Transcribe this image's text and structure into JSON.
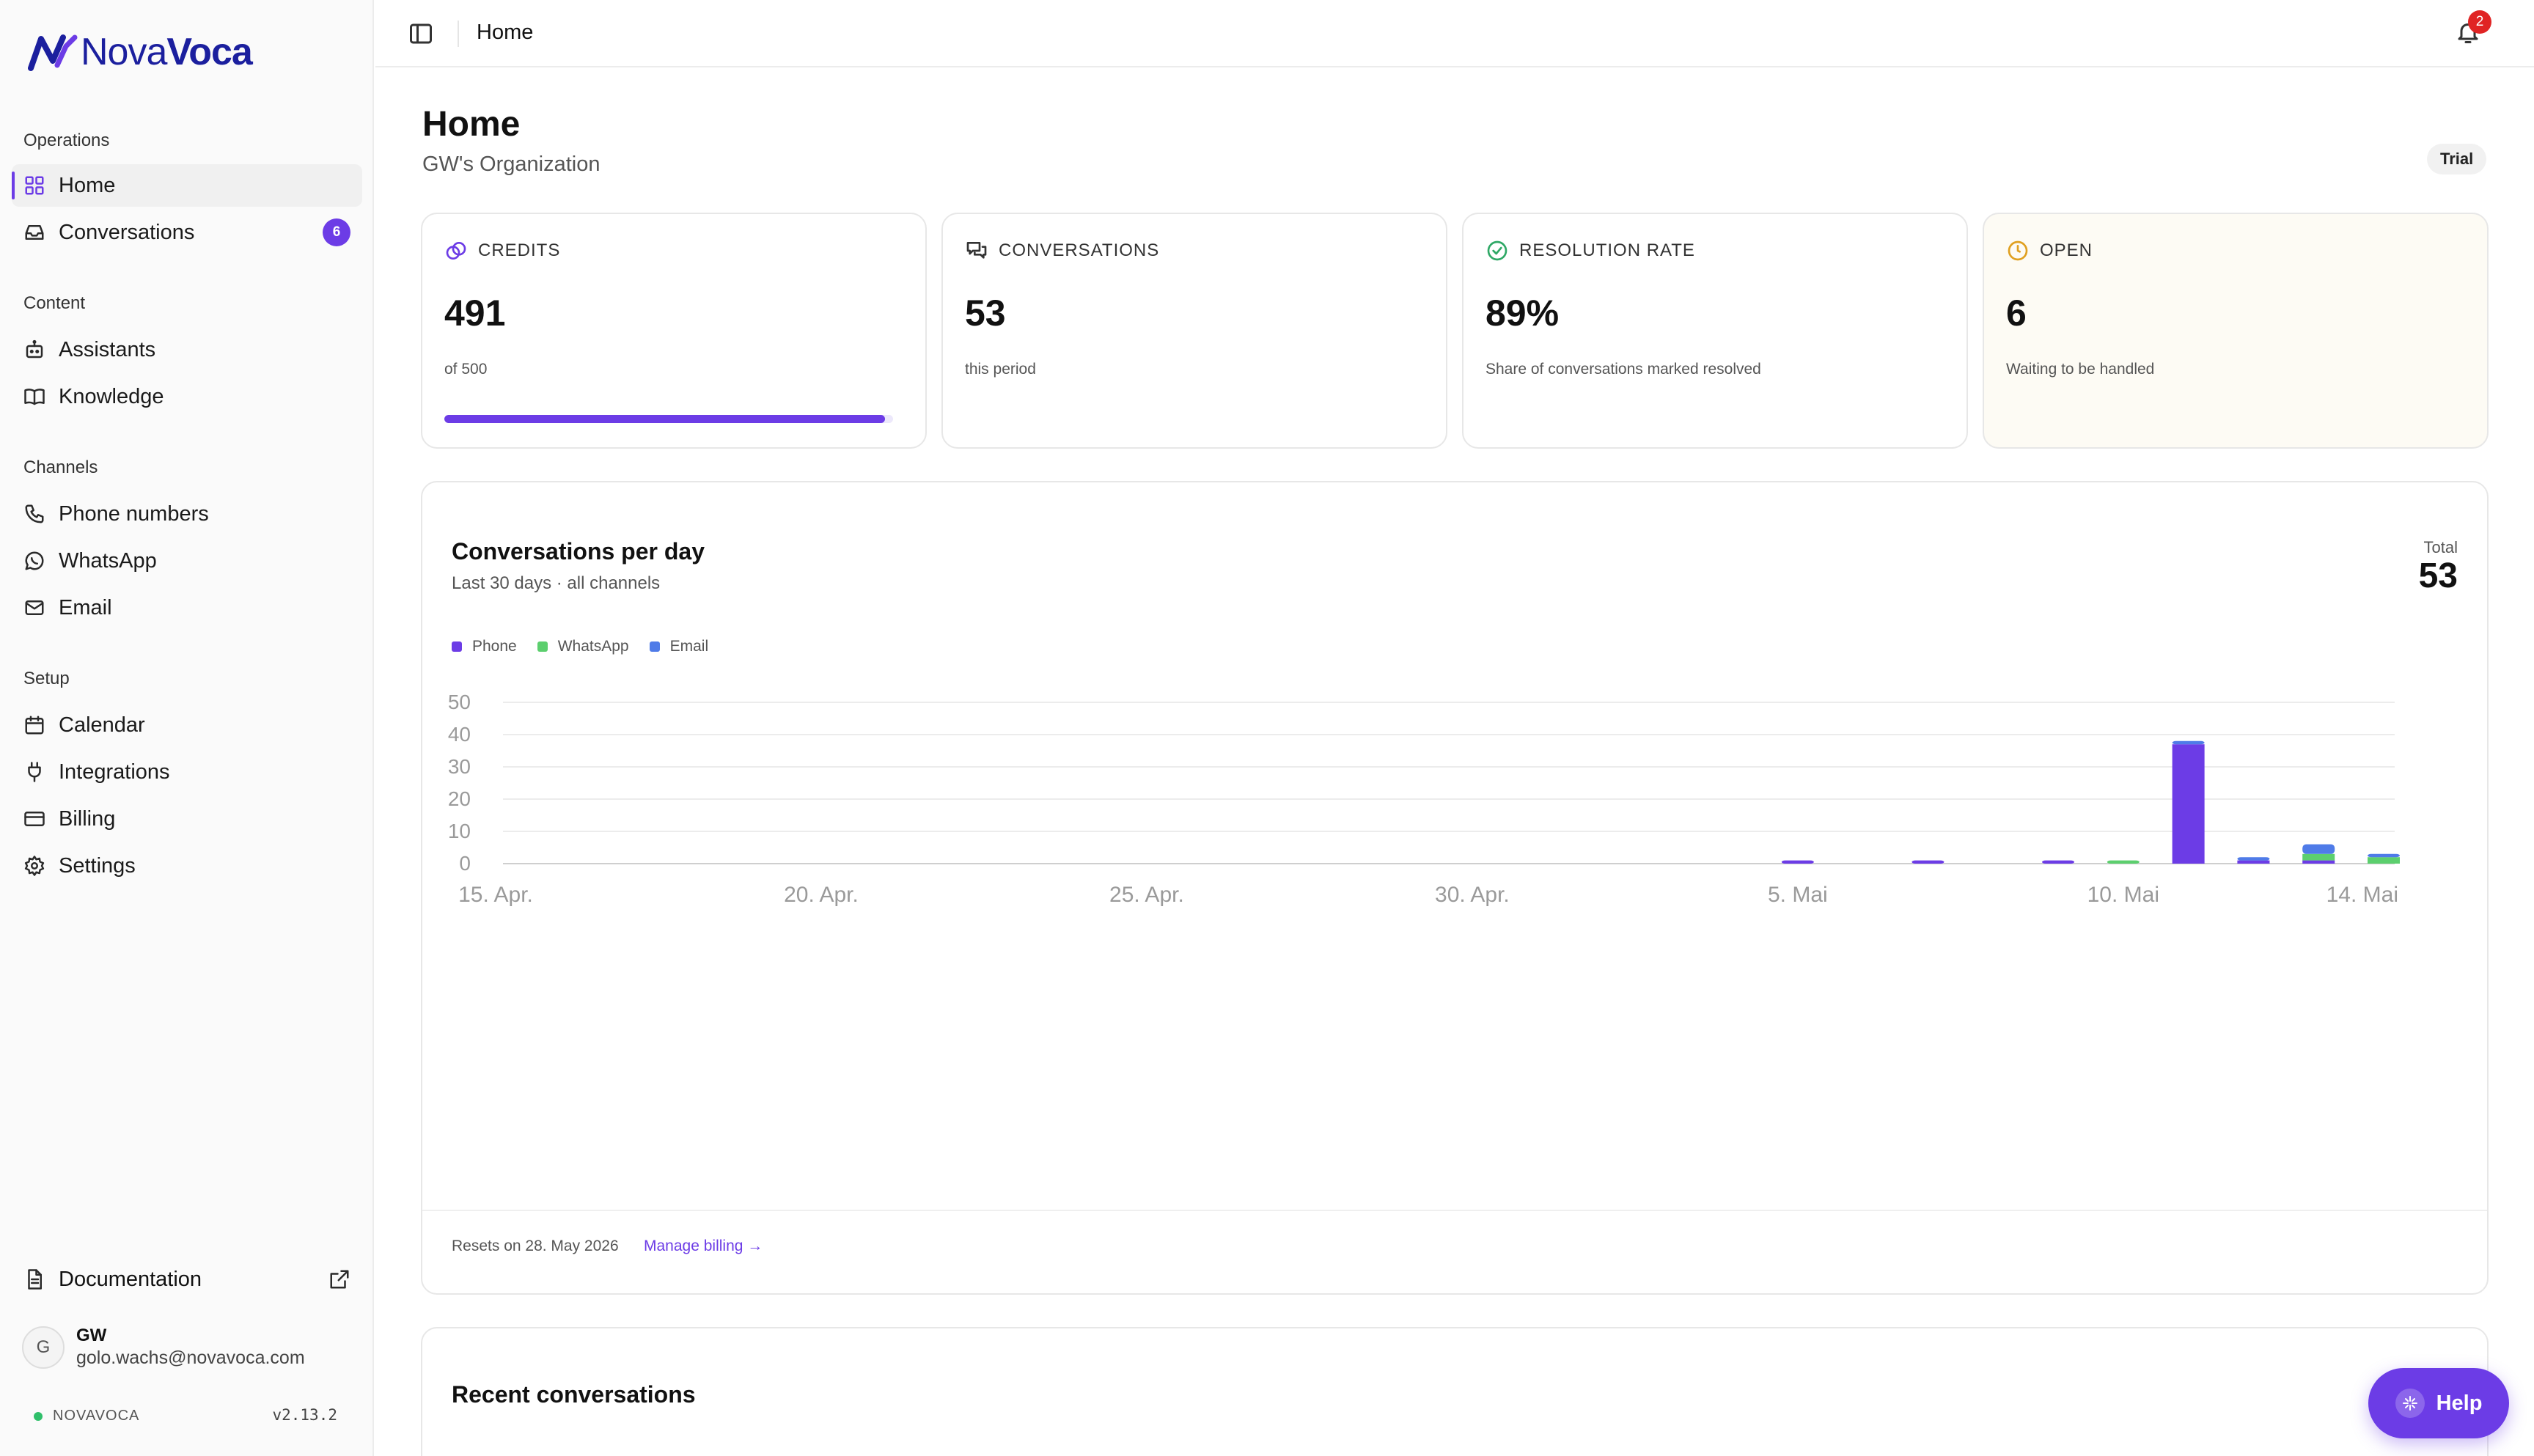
{
  "app": {
    "logo_light": "Nova",
    "logo_bold": "Voca",
    "brand_color": "#6c3ce6",
    "logo_color": "#1b1f9e"
  },
  "sidebar": {
    "sections": [
      {
        "label": "Operations"
      },
      {
        "label": "Content"
      },
      {
        "label": "Channels"
      },
      {
        "label": "Setup"
      }
    ],
    "items": [
      {
        "label": "Home",
        "icon": "grid-icon",
        "active": true
      },
      {
        "label": "Conversations",
        "icon": "inbox-icon",
        "badge": "6"
      },
      {
        "label": "Assistants",
        "icon": "bot-icon"
      },
      {
        "label": "Knowledge",
        "icon": "book-icon"
      },
      {
        "label": "Phone numbers",
        "icon": "phone-icon"
      },
      {
        "label": "WhatsApp",
        "icon": "whatsapp-icon"
      },
      {
        "label": "Email",
        "icon": "mail-icon"
      },
      {
        "label": "Calendar",
        "icon": "calendar-icon"
      },
      {
        "label": "Integrations",
        "icon": "plug-icon"
      },
      {
        "label": "Billing",
        "icon": "credit-card-icon"
      },
      {
        "label": "Settings",
        "icon": "gear-icon"
      }
    ],
    "documentation": "Documentation",
    "user": {
      "initial": "G",
      "name": "GW",
      "email": "golo.wachs@novavoca.com"
    },
    "footer_brand": "NOVAVOCA",
    "version": "v2.13.2"
  },
  "topbar": {
    "title": "Home",
    "notifications": "2"
  },
  "page": {
    "title": "Home",
    "subtitle": "GW's Organization",
    "plan": "Trial"
  },
  "stats": [
    {
      "label": "CREDITS",
      "value": "491",
      "sub": "of 500",
      "icon": "credits-icon",
      "progress": 0.982
    },
    {
      "label": "CONVERSATIONS",
      "value": "53",
      "sub": "this period",
      "icon": "chat-icon"
    },
    {
      "label": "RESOLUTION RATE",
      "value": "89%",
      "sub": "Share of conversations marked resolved",
      "icon": "check-circle-icon"
    },
    {
      "label": "OPEN",
      "value": "6",
      "sub": "Waiting to be handled",
      "icon": "clock-circle-icon"
    }
  ],
  "chart_card": {
    "title": "Conversations per day",
    "subtitle": "Last 30 days · all channels",
    "total_label": "Total",
    "total_value": "53",
    "reset_text": "Resets on 28. May 2026",
    "manage_link": "Manage billing →"
  },
  "chart_data": {
    "type": "bar",
    "stacked": true,
    "x_tick_labels": [
      "15. Apr.",
      "20. Apr.",
      "25. Apr.",
      "30. Apr.",
      "5. Mai",
      "10. Mai",
      "14. Mai"
    ],
    "x_tick_days": [
      0,
      5,
      10,
      15,
      20,
      25,
      29
    ],
    "ylim": [
      0,
      50
    ],
    "yticks": [
      0,
      10,
      20,
      30,
      40,
      50
    ],
    "grid": true,
    "legend_position": "top-left",
    "series": [
      {
        "name": "Phone",
        "color": "#6c3ce6",
        "values": [
          {
            "day": 20,
            "value": 1
          },
          {
            "day": 22,
            "value": 1
          },
          {
            "day": 24,
            "value": 1
          },
          {
            "day": 26,
            "value": 37
          },
          {
            "day": 27,
            "value": 1
          },
          {
            "day": 28,
            "value": 1
          },
          {
            "day": 29,
            "value": 0
          }
        ]
      },
      {
        "name": "WhatsApp",
        "color": "#5ccf6e",
        "values": [
          {
            "day": 25,
            "value": 1
          },
          {
            "day": 28,
            "value": 2
          },
          {
            "day": 29,
            "value": 2
          }
        ]
      },
      {
        "name": "Email",
        "color": "#4f7be8",
        "values": [
          {
            "day": 26,
            "value": 1
          },
          {
            "day": 27,
            "value": 1
          },
          {
            "day": 28,
            "value": 3
          },
          {
            "day": 29,
            "value": 1
          }
        ]
      }
    ]
  },
  "recent": {
    "title": "Recent conversations"
  },
  "help": {
    "label": "Help"
  }
}
